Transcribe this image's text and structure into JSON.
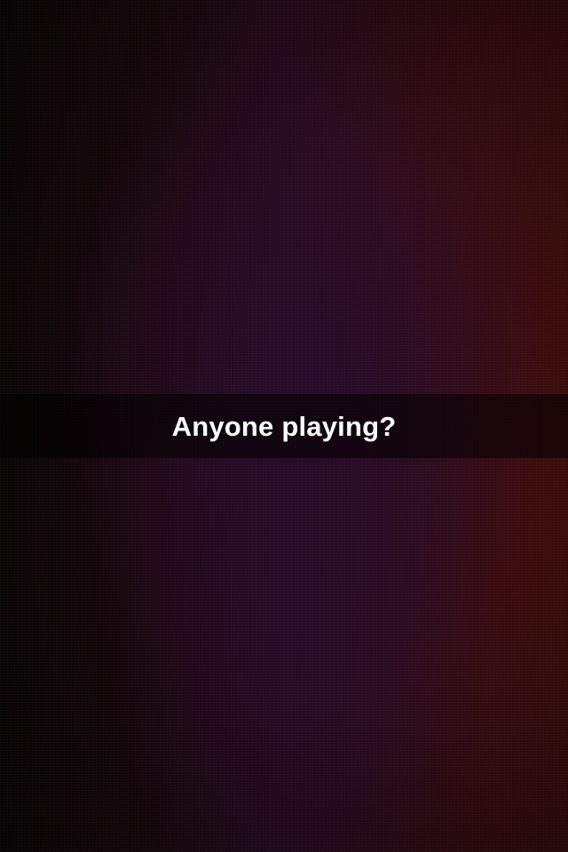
{
  "snap": {
    "caption": "Anyone playing?"
  },
  "colors": {
    "background_dark": "#0d0507",
    "background_purple": "#260a1c",
    "background_red": "#3f0d0d",
    "caption_bar": "#000000",
    "caption_text": "#ffffff"
  }
}
